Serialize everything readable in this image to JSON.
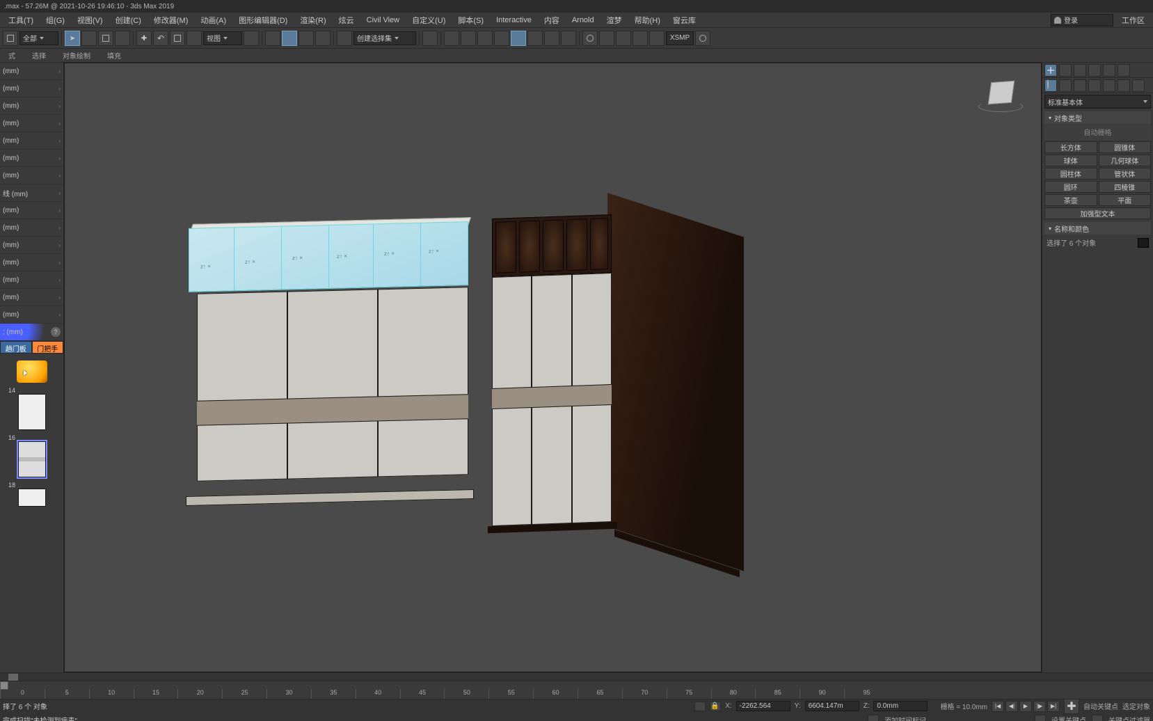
{
  "titlebar": ".max - 57.26M @ 2021-10-26 19:46:10 - 3ds Max 2019",
  "menu": {
    "items": [
      "工具(T)",
      "组(G)",
      "视图(V)",
      "创建(C)",
      "修改器(M)",
      "动画(A)",
      "图形编辑器(D)",
      "渲染(R)",
      "炫云",
      "Civil View",
      "自定义(U)",
      "脚本(S)",
      "Interactive",
      "内容",
      "Arnold",
      "渲梦",
      "帮助(H)",
      "窗云库"
    ],
    "login": "登录",
    "workspace": "工作区"
  },
  "toolbar": {
    "scope": "全部",
    "view": "视图",
    "selection_filter": "创建选择集",
    "xsmp": "XSMP"
  },
  "subtoolbar": {
    "tabs": [
      "式",
      "选择",
      "对象绘制",
      "填充"
    ]
  },
  "leftpanel": {
    "items": [
      "(mm)",
      "(mm)",
      "(mm)",
      "(mm)",
      "(mm)",
      "(mm)",
      "(mm)",
      "线 (mm)",
      "(mm)",
      "(mm)",
      "(mm)",
      "(mm)",
      "(mm)",
      "(mm)",
      "(mm)",
      "; (mm)"
    ],
    "help_icon": "?",
    "tabs": [
      "趟门板",
      "门把手"
    ],
    "thumbs": [
      {
        "label": ""
      },
      {
        "label": "14"
      },
      {
        "label": "16"
      },
      {
        "label": "18"
      }
    ]
  },
  "rightpanel": {
    "category": "标准基本体",
    "section_type": "对象类型",
    "autogrid": "自动栅格",
    "primitives": [
      [
        "长方体",
        "圆锥体"
      ],
      [
        "球体",
        "几何球体"
      ],
      [
        "圆柱体",
        "管状体"
      ],
      [
        "圆环",
        "四棱锥"
      ],
      [
        "茶壶",
        "平面"
      ],
      [
        "加强型文本",
        ""
      ]
    ],
    "section_name": "名称和颜色",
    "selection_text": "选择了 6 个对象"
  },
  "timeline": {
    "ticks": [
      "0",
      "5",
      "10",
      "15",
      "20",
      "25",
      "30",
      "35",
      "40",
      "45",
      "50",
      "55",
      "60",
      "65",
      "70",
      "75",
      "80",
      "85",
      "90",
      "95"
    ]
  },
  "status": {
    "selected": "择了 6 个 对象",
    "scan": "完成扫描\"未检测到病毒\"",
    "x_label": "X:",
    "x_val": "-2262.564",
    "y_label": "Y:",
    "y_val": "6604.147m",
    "z_label": "Z:",
    "z_val": "0.0mm",
    "grid": "栅格 = 10.0mm",
    "add_marker": "添加时间标记",
    "autokey": "自动关键点",
    "select_obj": "选定对象",
    "setkey": "设置关键点",
    "key_filter": "关键点过滤器"
  }
}
